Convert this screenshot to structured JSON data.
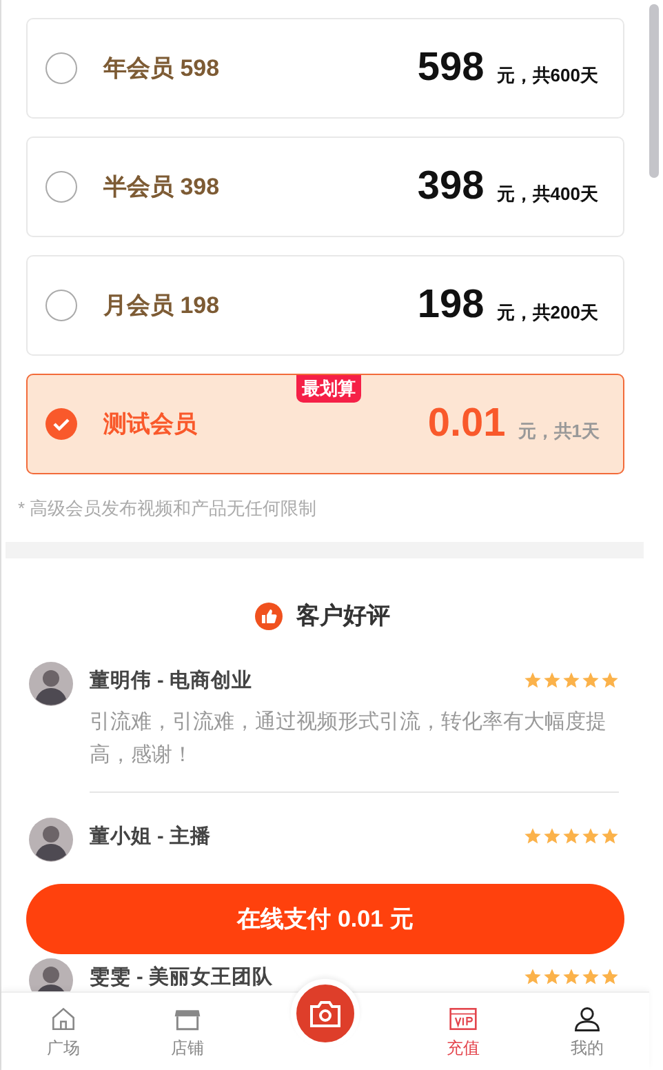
{
  "plans": [
    {
      "label": "年会员 598",
      "price": "598",
      "unit": "元，共600天",
      "selected": false
    },
    {
      "label": "半会员 398",
      "price": "398",
      "unit": "元，共400天",
      "selected": false
    },
    {
      "label": "月会员 198",
      "price": "198",
      "unit": "元，共200天",
      "selected": false
    },
    {
      "label": "测试会员",
      "price": "0.01",
      "unit": "元，共1天",
      "selected": true,
      "badge": "最划算"
    }
  ],
  "note": "* 高级会员发布视频和产品无任何限制",
  "reviews_title": "客户好评",
  "reviews": [
    {
      "name": "董明伟 - 电商创业",
      "stars": 5,
      "text": "引流难，引流难，通过视频形式引流，转化率有大幅度提高，感谢！"
    },
    {
      "name": "董小姐 - 主播",
      "stars": 5
    },
    {
      "name": "雯雯 - 美丽女王团队",
      "stars": 5
    }
  ],
  "pay_button": "在线支付 0.01 元",
  "tabs": [
    {
      "kind": "home",
      "label": "广场",
      "selected": false
    },
    {
      "kind": "shop",
      "label": "店铺",
      "selected": false
    },
    {
      "kind": "camera",
      "selected": false
    },
    {
      "kind": "vip",
      "label": "充值",
      "selected": true
    },
    {
      "kind": "user",
      "label": "我的",
      "selected": false
    }
  ]
}
